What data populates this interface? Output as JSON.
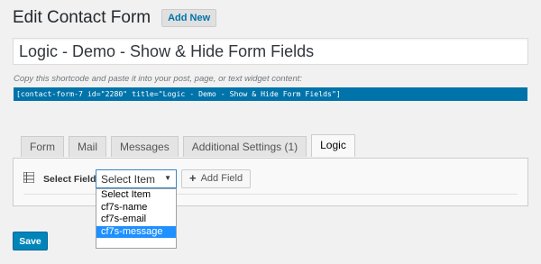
{
  "header": {
    "title": "Edit Contact Form",
    "add_new_label": "Add New"
  },
  "form_title": {
    "value": "Logic - Demo - Show & Hide Form Fields"
  },
  "shortcode": {
    "instruction": "Copy this shortcode and paste it into your post, page, or text widget content:",
    "code": "[contact-form-7 id=\"2280\" title=\"Logic - Demo - Show & Hide Form Fields\"]"
  },
  "tabs": [
    {
      "label": "Form"
    },
    {
      "label": "Mail"
    },
    {
      "label": "Messages"
    },
    {
      "label": "Additional Settings (1)"
    },
    {
      "label": "Logic",
      "active": true
    }
  ],
  "logic_panel": {
    "select_field_label": "Select Field",
    "select_value": "Select Item",
    "add_field_label": "Add Field",
    "dropdown_options": [
      "Select Item",
      "cf7s-name",
      "cf7s-email",
      "cf7s-message"
    ],
    "highlighted_option": "cf7s-message"
  },
  "footer": {
    "save_label": "Save"
  },
  "colors": {
    "accent": "#0073aa",
    "save_button": "#0085ba",
    "highlight": "#1e90ff",
    "background": "#f1f1f1"
  }
}
